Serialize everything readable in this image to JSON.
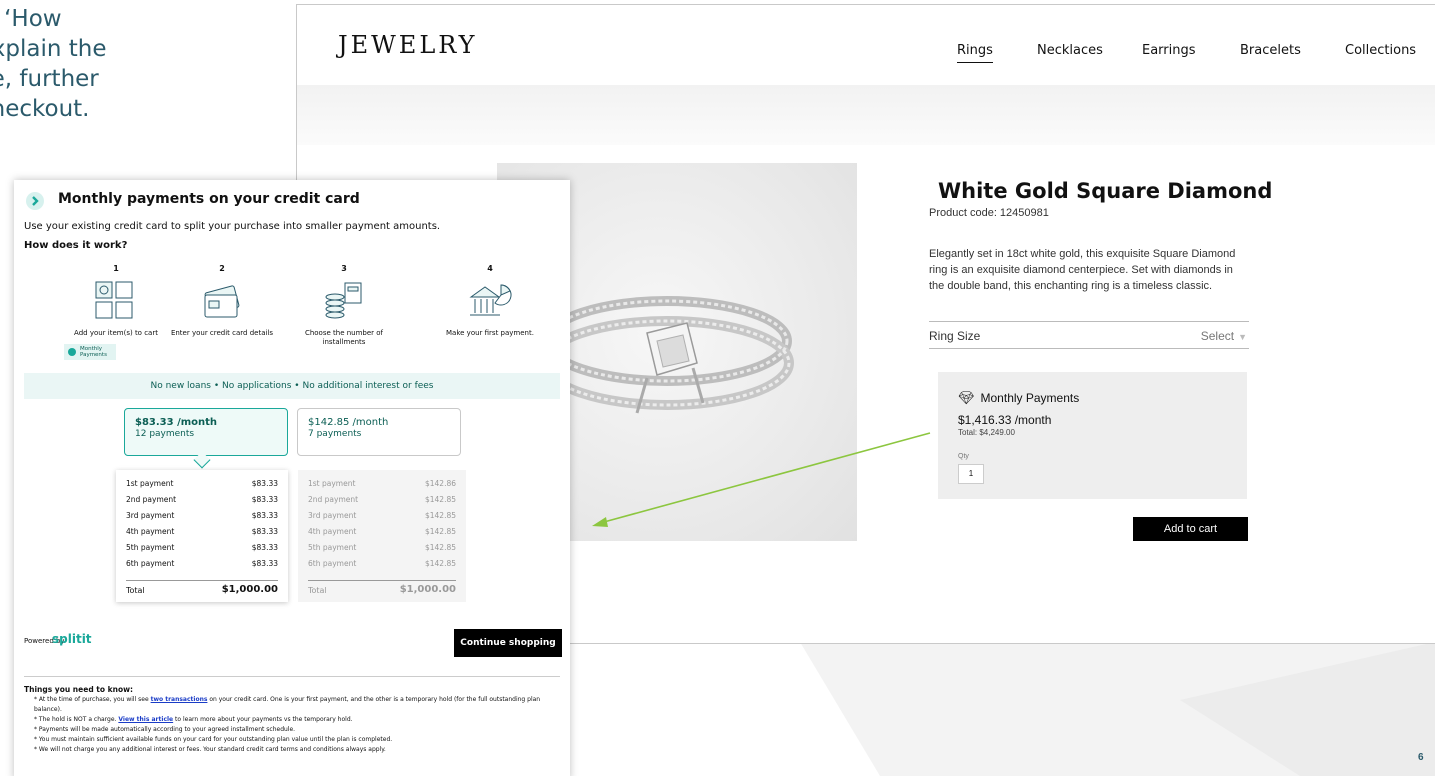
{
  "slide": {
    "heading_lines": [
      "w ‘How",
      "explain the",
      "ce, further",
      "checkout."
    ],
    "page_number": "6"
  },
  "site": {
    "brand": "JEWELRY",
    "nav": [
      {
        "label": "Rings",
        "active": true
      },
      {
        "label": "Necklaces",
        "active": false
      },
      {
        "label": "Earrings",
        "active": false
      },
      {
        "label": "Bracelets",
        "active": false
      },
      {
        "label": "Collections",
        "active": false
      }
    ],
    "product": {
      "title": "White Gold Square Diamond",
      "code": "Product code: 12450981",
      "description": "Elegantly set in 18ct white gold, this exquisite Square Diamond ring is an exquisite diamond centerpiece. Set with diamonds in the double band, this enchanting ring is a timeless classic.",
      "ring_size_label": "Ring Size",
      "ring_size_value": "Select"
    },
    "monthly_payments": {
      "title": "Monthly Payments",
      "amount": "$1,416.33 /month",
      "total": "Total: $4,249.00",
      "qty_label": "Qty",
      "qty_value": "1"
    },
    "add_to_cart": "Add to cart"
  },
  "modal": {
    "title": "Monthly payments on your credit card",
    "subtitle": "Use your existing credit card to split your purchase into smaller payment amounts.",
    "how_label": "How does it work?",
    "steps": [
      {
        "num": "1",
        "label": "Add your item(s) to cart"
      },
      {
        "num": "2",
        "label": "Enter your credit card details"
      },
      {
        "num": "3",
        "label": "Choose the number of installments"
      },
      {
        "num": "4",
        "label": "Make your first payment."
      }
    ],
    "mini_badge": "Monthly Payments",
    "benefits": "No new loans • No applications • No additional interest or fees",
    "plans": [
      {
        "amount": "$83.33 /month",
        "count": "12 payments",
        "selected": true
      },
      {
        "amount": "$142.85 /month",
        "count": "7 payments",
        "selected": false
      }
    ],
    "schedule_12": {
      "rows": [
        {
          "label": "1st payment",
          "value": "$83.33"
        },
        {
          "label": "2nd payment",
          "value": "$83.33"
        },
        {
          "label": "3rd payment",
          "value": "$83.33"
        },
        {
          "label": "4th payment",
          "value": "$83.33"
        },
        {
          "label": "5th payment",
          "value": "$83.33"
        },
        {
          "label": "6th payment",
          "value": "$83.33"
        }
      ],
      "total_label": "Total",
      "total_value": "$1,000.00"
    },
    "schedule_7": {
      "rows": [
        {
          "label": "1st payment",
          "value": "$142.86"
        },
        {
          "label": "2nd payment",
          "value": "$142.85"
        },
        {
          "label": "3rd payment",
          "value": "$142.85"
        },
        {
          "label": "4th payment",
          "value": "$142.85"
        },
        {
          "label": "5th payment",
          "value": "$142.85"
        },
        {
          "label": "6th payment",
          "value": "$142.85"
        }
      ],
      "total_label": "Total",
      "total_value": "$1,000.00"
    },
    "powered_by": "Powered by",
    "splitit_logo": "splitit",
    "continue_button": "Continue shopping",
    "things_title": "Things you need to know:",
    "things": {
      "item1_pre": "* At the time of purchase, you will see ",
      "item1_link": "two transactions",
      "item1_post": " on your credit card. One is your first payment, and the other is a temporary hold (for the full outstanding plan balance).",
      "item2_pre": "* The hold is NOT a charge. ",
      "item2_link": "View this article",
      "item2_post": " to learn more about your payments vs the temporary hold.",
      "item3": "* Payments will be made automatically according to your agreed installment schedule.",
      "item4": "* You must maintain sufficient available funds on your card for your outstanding plan value until the plan is completed.",
      "item5": "* We will not charge you any additional interest or fees. Your standard credit card terms and conditions always apply."
    }
  },
  "colors": {
    "accent_teal": "#1aa89a",
    "heading_teal": "#2b5a6b",
    "arrow_green": "#8cc63f"
  }
}
